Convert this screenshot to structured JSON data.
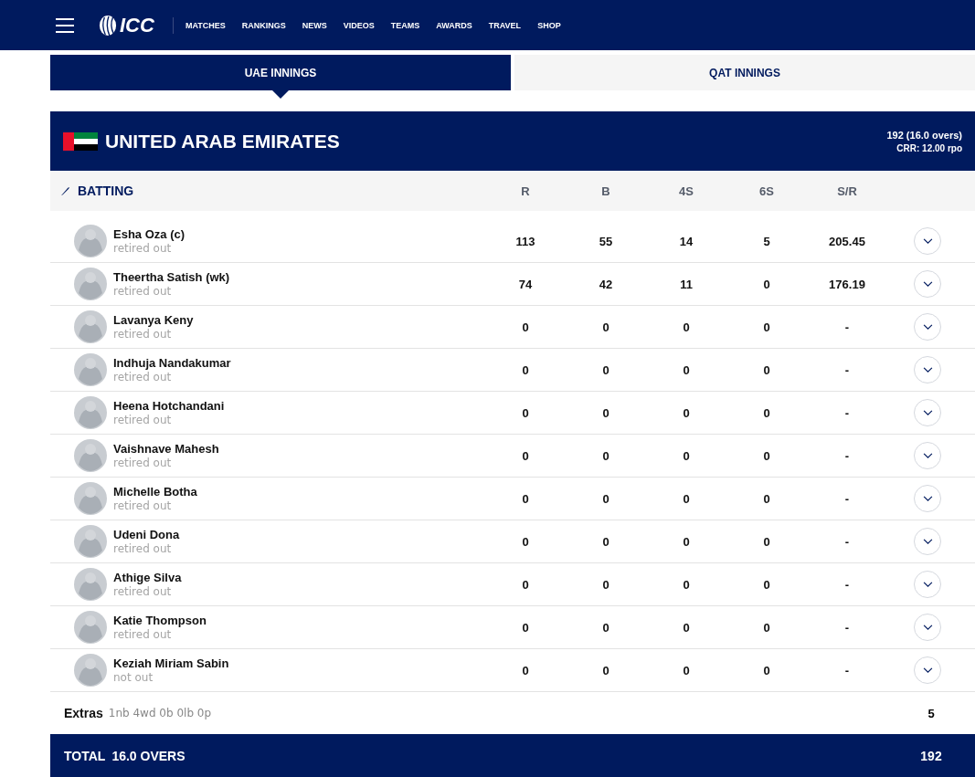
{
  "nav": {
    "logo": "ICC",
    "items": [
      "MATCHES",
      "RANKINGS",
      "NEWS",
      "VIDEOS",
      "TEAMS",
      "AWARDS",
      "TRAVEL",
      "SHOP"
    ]
  },
  "tabs": [
    {
      "label": "UAE INNINGS",
      "selected": true
    },
    {
      "label": "QAT INNINGS",
      "selected": false
    }
  ],
  "team": {
    "name": "UNITED ARAB EMIRATES",
    "score": "192 (16.0 overs)",
    "crr": "CRR: 12.00 rpo"
  },
  "batting": {
    "title": "BATTING",
    "columns": [
      "R",
      "B",
      "4S",
      "6S",
      "S/R"
    ],
    "rows": [
      {
        "name": "Esha Oza (c)",
        "dismissal": "retired out",
        "stats": [
          "113",
          "55",
          "14",
          "5",
          "205.45"
        ]
      },
      {
        "name": "Theertha Satish (wk)",
        "dismissal": "retired out",
        "stats": [
          "74",
          "42",
          "11",
          "0",
          "176.19"
        ]
      },
      {
        "name": "Lavanya Keny",
        "dismissal": "retired out",
        "stats": [
          "0",
          "0",
          "0",
          "0",
          "-"
        ]
      },
      {
        "name": "Indhuja Nandakumar",
        "dismissal": "retired out",
        "stats": [
          "0",
          "0",
          "0",
          "0",
          "-"
        ]
      },
      {
        "name": "Heena Hotchandani",
        "dismissal": "retired out",
        "stats": [
          "0",
          "0",
          "0",
          "0",
          "-"
        ]
      },
      {
        "name": "Vaishnave Mahesh",
        "dismissal": "retired out",
        "stats": [
          "0",
          "0",
          "0",
          "0",
          "-"
        ]
      },
      {
        "name": "Michelle Botha",
        "dismissal": "retired out",
        "stats": [
          "0",
          "0",
          "0",
          "0",
          "-"
        ]
      },
      {
        "name": "Udeni Dona",
        "dismissal": "retired out",
        "stats": [
          "0",
          "0",
          "0",
          "0",
          "-"
        ]
      },
      {
        "name": "Athige Silva",
        "dismissal": "retired out",
        "stats": [
          "0",
          "0",
          "0",
          "0",
          "-"
        ]
      },
      {
        "name": "Katie Thompson",
        "dismissal": "retired out",
        "stats": [
          "0",
          "0",
          "0",
          "0",
          "-"
        ]
      },
      {
        "name": "Keziah Miriam Sabin",
        "dismissal": "not out",
        "stats": [
          "0",
          "0",
          "0",
          "0",
          "-"
        ]
      }
    ],
    "extras": {
      "label": "Extras",
      "detail": "1nb 4wd 0b 0lb 0p",
      "value": "5"
    },
    "total": {
      "label": "TOTAL",
      "overs": "16.0 OVERS",
      "value": "192"
    }
  }
}
